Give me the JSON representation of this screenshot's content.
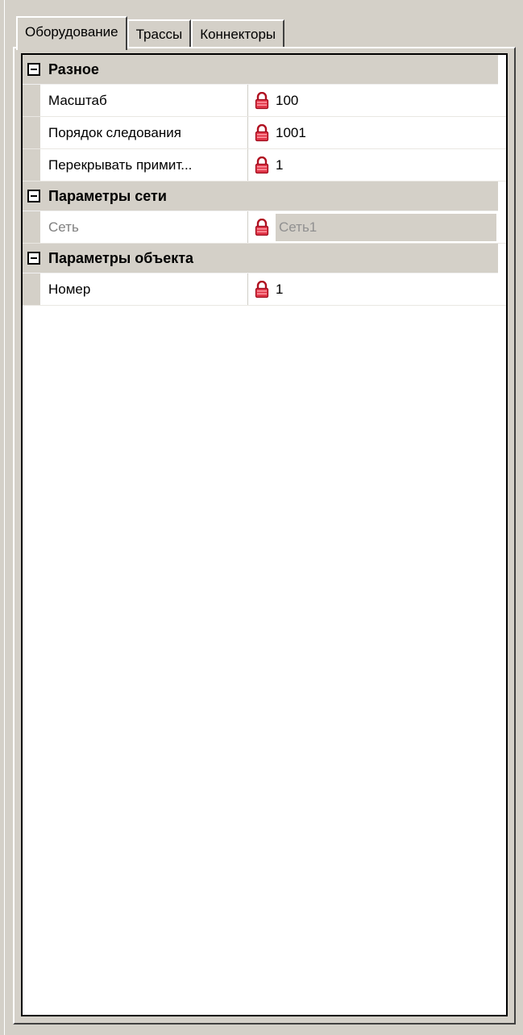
{
  "tabs": [
    {
      "label": "Оборудование",
      "active": true
    },
    {
      "label": "Трассы",
      "active": false
    },
    {
      "label": "Коннекторы",
      "active": false
    }
  ],
  "categories": [
    {
      "label": "Разное",
      "rows": [
        {
          "name": "Масштаб",
          "value": "100"
        },
        {
          "name": "Порядок следования",
          "value": "1001"
        },
        {
          "name": "Перекрывать примит...",
          "value": "1"
        }
      ]
    },
    {
      "label": "Параметры сети",
      "rows": [
        {
          "name": "Сеть",
          "value": "Сеть1",
          "disabled": true
        }
      ]
    },
    {
      "label": "Параметры объекта",
      "rows": [
        {
          "name": "Номер",
          "value": "1"
        }
      ]
    }
  ],
  "icons": {
    "lock": "lock-icon",
    "expander": "collapse-minus-icon"
  },
  "colors": {
    "panel": "#d4d0c8",
    "lock": "#c8102e",
    "grid_bg": "#ffffff"
  }
}
